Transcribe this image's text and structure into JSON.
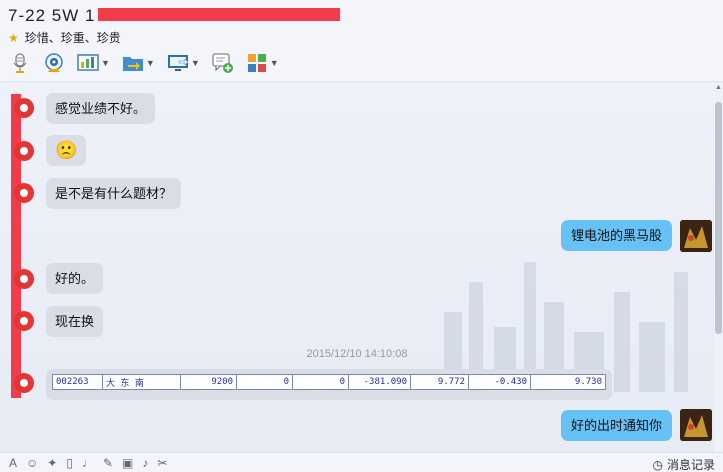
{
  "header": {
    "title": "7-22  5W  1",
    "tags": "珍惜、珍重、珍贵"
  },
  "toolbar": {
    "items": [
      {
        "icon": "microphone-icon"
      },
      {
        "icon": "video-camera-icon"
      },
      {
        "icon": "chart-icon"
      },
      {
        "icon": "folder-send-icon"
      },
      {
        "icon": "remote-desktop-icon"
      },
      {
        "icon": "add-chat-icon"
      },
      {
        "icon": "apps-icon"
      }
    ]
  },
  "messages": [
    {
      "side": "left",
      "text": "感觉业绩不好。"
    },
    {
      "side": "left",
      "text": "🙁"
    },
    {
      "side": "left",
      "text": "是不是有什么题材？"
    },
    {
      "side": "right",
      "text": "锂电池的黑马股"
    },
    {
      "side": "left",
      "text": "好的。"
    },
    {
      "side": "left",
      "text": "现在换"
    },
    {
      "side": "right",
      "text": "好的出时通知你"
    }
  ],
  "timestamp": "2015/12/10 14:10:08",
  "stock_row": [
    "002263",
    "大 东 南",
    "9200",
    "0",
    "0",
    "-381.090",
    "9.772",
    "-0.430",
    "9.730"
  ],
  "bottom_bar": {
    "icons": [
      "font-icon",
      "emoji-icon",
      "magic-icon",
      "vibrate-icon",
      "voice-icon",
      "pencil-icon",
      "image-icon",
      "music-icon",
      "scissors-icon"
    ],
    "history_label": "消息记录"
  },
  "colors": {
    "bubble_left": "#d8dde6",
    "bubble_right": "#67c1f4",
    "redaction": "#f23c4b"
  }
}
